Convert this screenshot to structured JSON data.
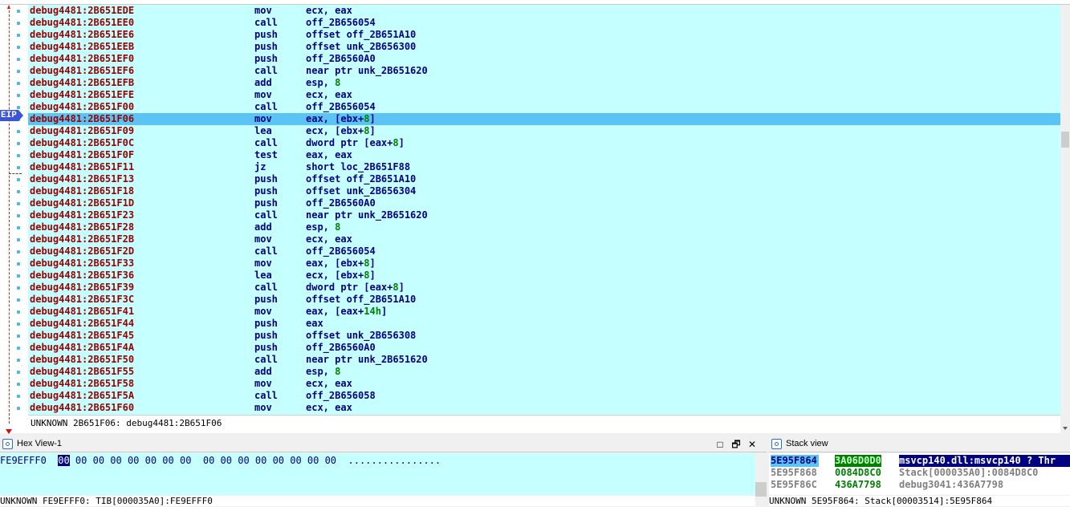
{
  "disassembly": {
    "eip_label": "EIP",
    "rows": [
      {
        "addr": "debug4481:2B651EDE",
        "mnem": "mov",
        "ops": [
          [
            "ecx, eax",
            false
          ]
        ]
      },
      {
        "addr": "debug4481:2B651EE0",
        "mnem": "call",
        "ops": [
          [
            "off_2B656054",
            false
          ]
        ]
      },
      {
        "addr": "debug4481:2B651EE6",
        "mnem": "push",
        "ops": [
          [
            "offset off_2B651A10",
            false
          ]
        ]
      },
      {
        "addr": "debug4481:2B651EEB",
        "mnem": "push",
        "ops": [
          [
            "offset unk_2B656300",
            false
          ]
        ]
      },
      {
        "addr": "debug4481:2B651EF0",
        "mnem": "push",
        "ops": [
          [
            "off_2B6560A0",
            false
          ]
        ]
      },
      {
        "addr": "debug4481:2B651EF6",
        "mnem": "call",
        "ops": [
          [
            "near ptr unk_2B651620",
            false
          ]
        ]
      },
      {
        "addr": "debug4481:2B651EFB",
        "mnem": "add",
        "ops": [
          [
            "esp, ",
            false
          ],
          [
            "8",
            true
          ]
        ]
      },
      {
        "addr": "debug4481:2B651EFE",
        "mnem": "mov",
        "ops": [
          [
            "ecx, eax",
            false
          ]
        ]
      },
      {
        "addr": "debug4481:2B651F00",
        "mnem": "call",
        "ops": [
          [
            "off_2B656054",
            false
          ]
        ]
      },
      {
        "addr": "debug4481:2B651F06",
        "mnem": "mov",
        "ops": [
          [
            "eax, [ebx+",
            false
          ],
          [
            "8",
            true
          ],
          [
            "]",
            false
          ]
        ],
        "current": true
      },
      {
        "addr": "debug4481:2B651F09",
        "mnem": "lea",
        "ops": [
          [
            "ecx, [ebx+",
            false
          ],
          [
            "8",
            true
          ],
          [
            "]",
            false
          ]
        ]
      },
      {
        "addr": "debug4481:2B651F0C",
        "mnem": "call",
        "ops": [
          [
            "dword ptr [eax+",
            false
          ],
          [
            "8",
            true
          ],
          [
            "]",
            false
          ]
        ]
      },
      {
        "addr": "debug4481:2B651F0F",
        "mnem": "test",
        "ops": [
          [
            "eax, eax",
            false
          ]
        ]
      },
      {
        "addr": "debug4481:2B651F11",
        "mnem": "jz",
        "ops": [
          [
            "short loc_2B651F88",
            false
          ]
        ]
      },
      {
        "addr": "debug4481:2B651F13",
        "mnem": "push",
        "ops": [
          [
            "offset off_2B651A10",
            false
          ]
        ]
      },
      {
        "addr": "debug4481:2B651F18",
        "mnem": "push",
        "ops": [
          [
            "offset unk_2B656304",
            false
          ]
        ]
      },
      {
        "addr": "debug4481:2B651F1D",
        "mnem": "push",
        "ops": [
          [
            "off_2B6560A0",
            false
          ]
        ]
      },
      {
        "addr": "debug4481:2B651F23",
        "mnem": "call",
        "ops": [
          [
            "near ptr unk_2B651620",
            false
          ]
        ]
      },
      {
        "addr": "debug4481:2B651F28",
        "mnem": "add",
        "ops": [
          [
            "esp, ",
            false
          ],
          [
            "8",
            true
          ]
        ]
      },
      {
        "addr": "debug4481:2B651F2B",
        "mnem": "mov",
        "ops": [
          [
            "ecx, eax",
            false
          ]
        ]
      },
      {
        "addr": "debug4481:2B651F2D",
        "mnem": "call",
        "ops": [
          [
            "off_2B656054",
            false
          ]
        ]
      },
      {
        "addr": "debug4481:2B651F33",
        "mnem": "mov",
        "ops": [
          [
            "eax, [ebx+",
            false
          ],
          [
            "8",
            true
          ],
          [
            "]",
            false
          ]
        ]
      },
      {
        "addr": "debug4481:2B651F36",
        "mnem": "lea",
        "ops": [
          [
            "ecx, [ebx+",
            false
          ],
          [
            "8",
            true
          ],
          [
            "]",
            false
          ]
        ]
      },
      {
        "addr": "debug4481:2B651F39",
        "mnem": "call",
        "ops": [
          [
            "dword ptr [eax+",
            false
          ],
          [
            "8",
            true
          ],
          [
            "]",
            false
          ]
        ]
      },
      {
        "addr": "debug4481:2B651F3C",
        "mnem": "push",
        "ops": [
          [
            "offset off_2B651A10",
            false
          ]
        ]
      },
      {
        "addr": "debug4481:2B651F41",
        "mnem": "mov",
        "ops": [
          [
            "eax, [eax+",
            false
          ],
          [
            "14h",
            true
          ],
          [
            "]",
            false
          ]
        ]
      },
      {
        "addr": "debug4481:2B651F44",
        "mnem": "push",
        "ops": [
          [
            "eax",
            false
          ]
        ]
      },
      {
        "addr": "debug4481:2B651F45",
        "mnem": "push",
        "ops": [
          [
            "offset unk_2B656308",
            false
          ]
        ]
      },
      {
        "addr": "debug4481:2B651F4A",
        "mnem": "push",
        "ops": [
          [
            "off_2B6560A0",
            false
          ]
        ]
      },
      {
        "addr": "debug4481:2B651F50",
        "mnem": "call",
        "ops": [
          [
            "near ptr unk_2B651620",
            false
          ]
        ]
      },
      {
        "addr": "debug4481:2B651F55",
        "mnem": "add",
        "ops": [
          [
            "esp, ",
            false
          ],
          [
            "8",
            true
          ]
        ]
      },
      {
        "addr": "debug4481:2B651F58",
        "mnem": "mov",
        "ops": [
          [
            "ecx, eax",
            false
          ]
        ]
      },
      {
        "addr": "debug4481:2B651F5A",
        "mnem": "call",
        "ops": [
          [
            "off_2B656058",
            false
          ]
        ]
      },
      {
        "addr": "debug4481:2B651F60",
        "mnem": "mov",
        "ops": [
          [
            "ecx, eax",
            false
          ]
        ]
      }
    ],
    "status": "UNKNOWN 2B651F06: debug4481:2B651F06"
  },
  "hex_view": {
    "title": "Hex View-1",
    "buttons": [
      "□",
      "🗗",
      "✕"
    ],
    "address": "FE9EFFF0",
    "first_byte": "00",
    "rest_bytes": " 00 00 00 00 00 00 00  00 00 00 00 00 00 00 00",
    "ascii": "................",
    "status": "UNKNOWN FE9EFFF0: TIB[000035A0]:FE9EFFF0"
  },
  "stack_view": {
    "title": "Stack view",
    "rows": [
      {
        "addr": "5E95F864",
        "val": "3A06D0D0",
        "comment": "msvcp140.dll:msvcp140 ? Thr",
        "selected": true
      },
      {
        "addr": "5E95F868",
        "val": "0084D8C0",
        "comment": "Stack[000035A0]:0084D8C0",
        "selected": false
      },
      {
        "addr": "5E95F86C",
        "val": "436A7798",
        "comment": "debug3041:436A7798",
        "selected": false
      }
    ],
    "status": "UNKNOWN 5E95F864: Stack[00003514]:5E95F864"
  },
  "colors": {
    "listing_bg": "#c6ffff",
    "highlight": "#5cc4f4",
    "address": "#990000",
    "instruction": "#000080",
    "number": "#008000"
  }
}
